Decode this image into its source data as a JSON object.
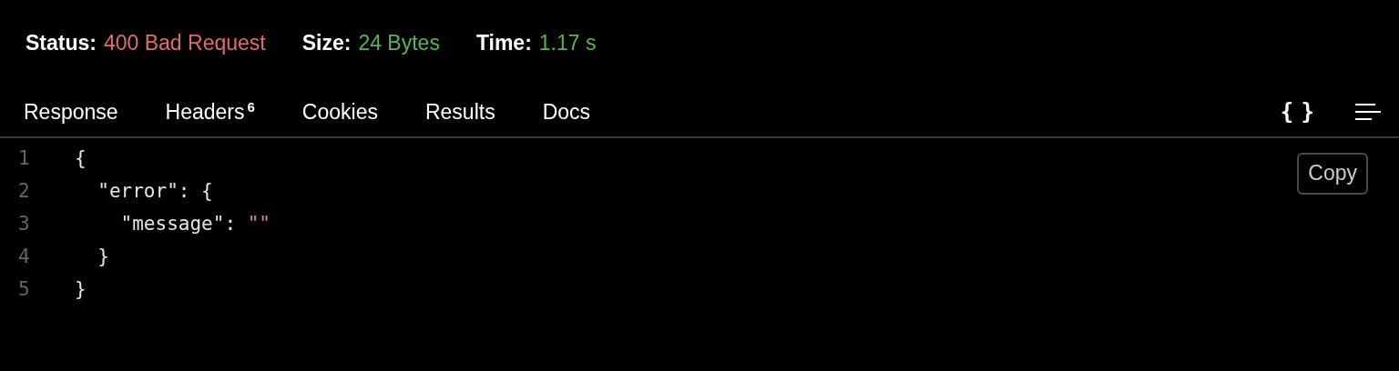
{
  "status_bar": [
    {
      "label": "Status:",
      "value": "400 Bad Request",
      "color": "#e06c6c"
    },
    {
      "label": "Size:",
      "value": "24 Bytes",
      "color": "#5bb450"
    },
    {
      "label": "Time:",
      "value": "1.17 s",
      "color": "#5bb450"
    }
  ],
  "tabs": [
    {
      "label": "Response"
    },
    {
      "label": "Headers",
      "count": "6"
    },
    {
      "label": "Cookies"
    },
    {
      "label": "Results"
    },
    {
      "label": "Docs"
    }
  ],
  "toolbar": {
    "format_toggle": "{ }"
  },
  "code": {
    "lines": [
      {
        "number": "1",
        "segments": [
          {
            "kind": "punct",
            "text": "{"
          }
        ]
      },
      {
        "number": "2",
        "segments": [
          {
            "kind": "key",
            "text": "  \"error\""
          },
          {
            "kind": "punct",
            "text": ": {"
          }
        ]
      },
      {
        "number": "3",
        "segments": [
          {
            "kind": "key",
            "text": "    \"message\""
          },
          {
            "kind": "punct",
            "text": ": "
          },
          {
            "kind": "string",
            "text": "\"\""
          }
        ]
      },
      {
        "number": "4",
        "segments": [
          {
            "kind": "punct",
            "text": "  }"
          }
        ]
      },
      {
        "number": "5",
        "segments": [
          {
            "kind": "punct",
            "text": "}"
          }
        ]
      }
    ],
    "copy_button": "Copy"
  }
}
